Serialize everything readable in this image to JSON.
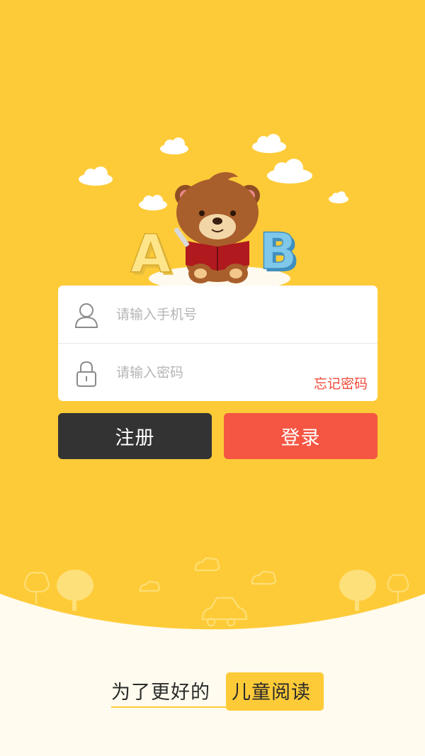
{
  "login": {
    "phone_placeholder": "请输入手机号",
    "password_placeholder": "请输入密码",
    "forgot_label": "忘记密码"
  },
  "actions": {
    "register_label": "注册",
    "login_label": "登录"
  },
  "slogan": {
    "left": "为了更好的",
    "right": "儿童阅读"
  },
  "illustration": {
    "letters": [
      "A",
      "B"
    ]
  },
  "colors": {
    "background": "#fecb38",
    "register_button": "#333333",
    "login_button": "#f45643",
    "forgot_link": "#f04a3b",
    "footer_background": "#fffbee"
  },
  "icons": [
    "user-icon",
    "lock-icon",
    "bear-mascot",
    "cloud-icon",
    "tree-icon",
    "car-icon"
  ]
}
